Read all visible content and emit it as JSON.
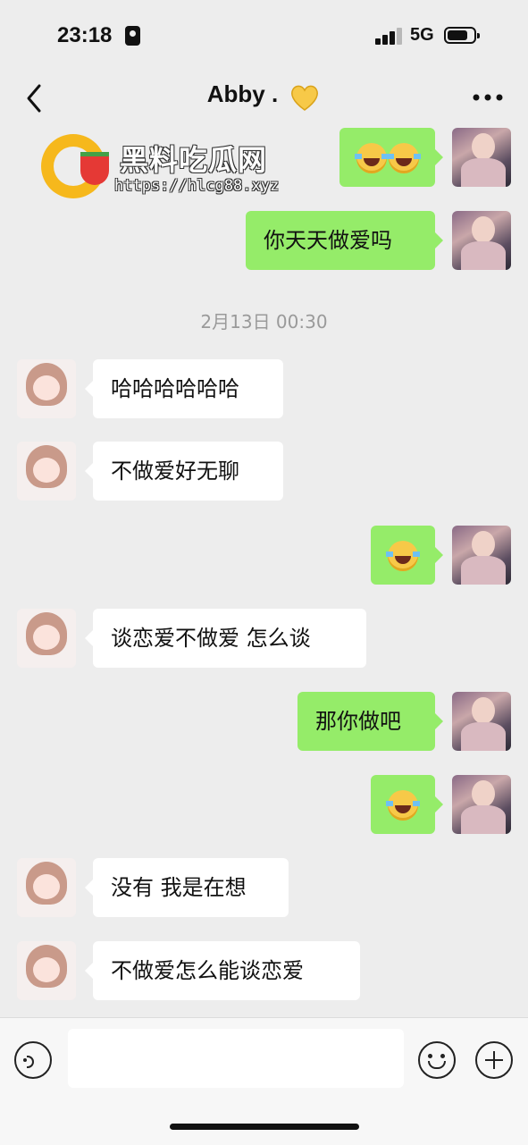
{
  "status_bar": {
    "time": "23:18",
    "network": "5G"
  },
  "header": {
    "title": "Abby .",
    "title_emoji_icon": "yellow-heart-icon"
  },
  "watermark": {
    "name": "黑料吃瓜网",
    "url": "https://hlcg88.xyz"
  },
  "date_separator": "2月13日 00:30",
  "messages": [
    {
      "sender": "me",
      "type": "emoji",
      "content": "",
      "emoji_icons": [
        "rolling-laughing-icon",
        "rolling-laughing-icon"
      ]
    },
    {
      "sender": "me",
      "type": "text",
      "content": "你天天做爱吗"
    },
    {
      "sender": "abby",
      "type": "text",
      "content": "哈哈哈哈哈哈"
    },
    {
      "sender": "abby",
      "type": "text",
      "content": "不做爱好无聊"
    },
    {
      "sender": "me",
      "type": "emoji",
      "content": "",
      "emoji_icons": [
        "rolling-laughing-icon"
      ]
    },
    {
      "sender": "abby",
      "type": "text",
      "content": "谈恋爱不做爱 怎么谈"
    },
    {
      "sender": "me",
      "type": "text",
      "content": "那你做吧"
    },
    {
      "sender": "me",
      "type": "emoji",
      "content": "",
      "emoji_icons": [
        "rolling-laughing-icon"
      ]
    },
    {
      "sender": "abby",
      "type": "text",
      "content": "没有 我是在想"
    },
    {
      "sender": "abby",
      "type": "text",
      "content": "不做爱怎么能谈恋爱"
    }
  ],
  "input_bar": {
    "placeholder": "",
    "left_icon": "voice-icon",
    "right_icons": [
      "emoji-smile-icon",
      "plus-icon"
    ]
  },
  "colors": {
    "my_bubble": "#95ec69",
    "their_bubble": "#ffffff",
    "background": "#ededed"
  }
}
